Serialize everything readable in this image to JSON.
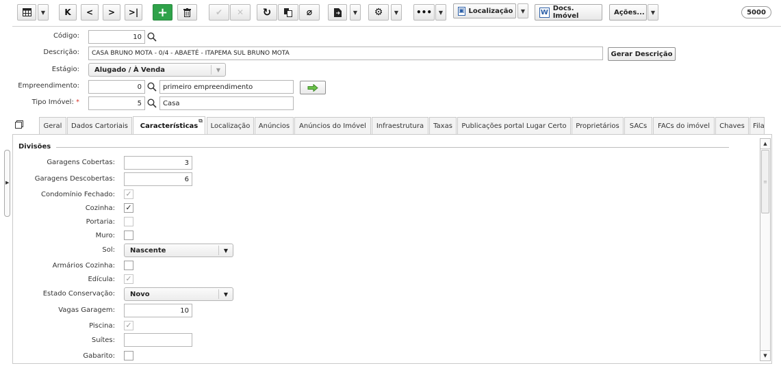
{
  "toolbar": {
    "localizacao_label": "Localização",
    "docs_label": "Docs. Imóvel",
    "acoes_label": "Ações...",
    "record_count": "5000"
  },
  "header": {
    "codigo_label": "Código:",
    "codigo_value": "10",
    "descricao_label": "Descrição:",
    "descricao_value": "CASA BRUNO MOTA - 0/4 - ABAETÉ - ITAPEMA SUL  BRUNO MOTA",
    "gerar_descricao_label": "Gerar Descrição",
    "estagio_label": "Estágio:",
    "estagio_value": "Alugado / À Venda",
    "empreendimento_label": "Empreendimento:",
    "empreendimento_code": "0",
    "empreendimento_name": "primeiro empreendimento",
    "tipo_imovel_label": "Tipo Imóvel:",
    "tipo_imovel_required": "*",
    "tipo_imovel_code": "5",
    "tipo_imovel_name": "Casa"
  },
  "tabs": [
    {
      "label": "Geral"
    },
    {
      "label": "Dados Cartoriais"
    },
    {
      "label": "Características",
      "active": true
    },
    {
      "label": "Localização"
    },
    {
      "label": "Anúncios"
    },
    {
      "label": "Anúncios do Imóvel"
    },
    {
      "label": "Infraestrutura"
    },
    {
      "label": "Taxas"
    },
    {
      "label": "Publicações portal Lugar Certo"
    },
    {
      "label": "Proprietários"
    },
    {
      "label": "SACs"
    },
    {
      "label": "FACs do imóvel"
    },
    {
      "label": "Chaves"
    },
    {
      "label": "Fila"
    }
  ],
  "divisoes": {
    "title": "Divisões",
    "garagens_cobertas_label": "Garagens Cobertas:",
    "garagens_cobertas_value": "3",
    "garagens_descobertas_label": "Garagens Descobertas:",
    "garagens_descobertas_value": "6",
    "condominio_fechado_label": "Condomínio Fechado:",
    "condominio_fechado_checked": true,
    "cozinha_label": "Cozinha:",
    "cozinha_checked": true,
    "portaria_label": "Portaria:",
    "portaria_checked": false,
    "muro_label": "Muro:",
    "muro_checked": false,
    "sol_label": "Sol:",
    "sol_value": "Nascente",
    "armarios_cozinha_label": "Armários Cozinha:",
    "armarios_cozinha_checked": false,
    "edicula_label": "Edícula:",
    "edicula_checked": true,
    "estado_conservacao_label": "Estado Conservação:",
    "estado_conservacao_value": "Novo",
    "vagas_garagem_label": "Vagas Garagem:",
    "vagas_garagem_value": "10",
    "piscina_label": "Piscina:",
    "piscina_checked": true,
    "suites_label": "Suítes:",
    "suites_value": "",
    "gabarito_label": "Gabarito:",
    "gabarito_checked": false
  },
  "colors": {
    "accent_green": "#2fa24a",
    "required_red": "#d9342b"
  }
}
